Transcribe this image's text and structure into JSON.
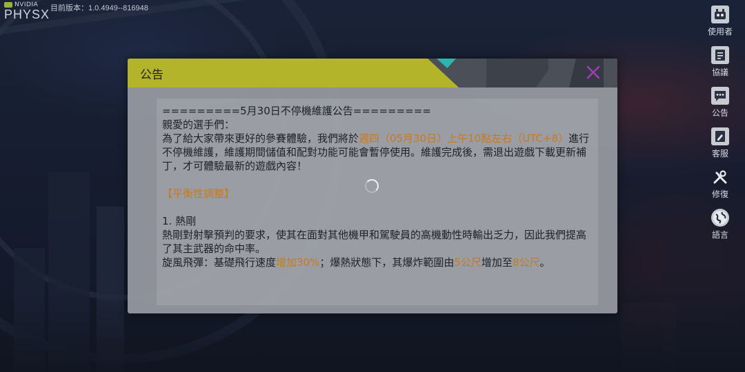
{
  "brand": {
    "nvidia": "NVIDIA",
    "physx": "PHYSX"
  },
  "version_text": "目前版本：1.0.4949--816948",
  "side_menu": [
    {
      "label": "使用者",
      "icon": "user-avatar-icon"
    },
    {
      "label": "協議",
      "icon": "document-icon"
    },
    {
      "label": "公告",
      "icon": "chat-bubble-icon"
    },
    {
      "label": "客服",
      "icon": "edit-note-icon"
    },
    {
      "label": "修復",
      "icon": "repair-tools-icon"
    },
    {
      "label": "語言",
      "icon": "globe-icon"
    }
  ],
  "dialog": {
    "title": "公告",
    "close_icon": "close-icon",
    "lines": {
      "header": "=========5月30日不停機維護公告=========",
      "greeting": "親愛的選手們：",
      "p1_a": "為了給大家帶來更好的參賽體驗，我們將於",
      "p1_hl1": "週四（05月30日）上午10點左右",
      "p1_hl2": "（UTC+8）",
      "p1_b": "進行不停機維護，維護期間儲值和配對功能可能會暫停使用。維護完成後，需退出遊戲下載更新補丁，才可體驗最新的遊戲內容！",
      "section_title": "【平衡性調整】",
      "item1_title": "1. 熱剛",
      "item1_desc": "熱剛對射擊預判的要求，使其在面對其他機甲和駕駛員的高機動性時輸出乏力，因此我們提高了其主武器的命中率。",
      "item1_skill_a": "旋風飛彈：基礎飛行速度",
      "item1_skill_hl1": "增加30%",
      "item1_skill_b": "；爆熱狀態下，其爆炸範圍由",
      "item1_skill_hl2": "5公尺",
      "item1_skill_c": "增加至",
      "item1_skill_hl3": "8公尺",
      "item1_skill_d": "。"
    }
  },
  "colors": {
    "highlight": "#c87a1a",
    "header_yellow": "#b3b429",
    "close": "#a03bb8",
    "accent_teal": "#2fb3ad"
  }
}
